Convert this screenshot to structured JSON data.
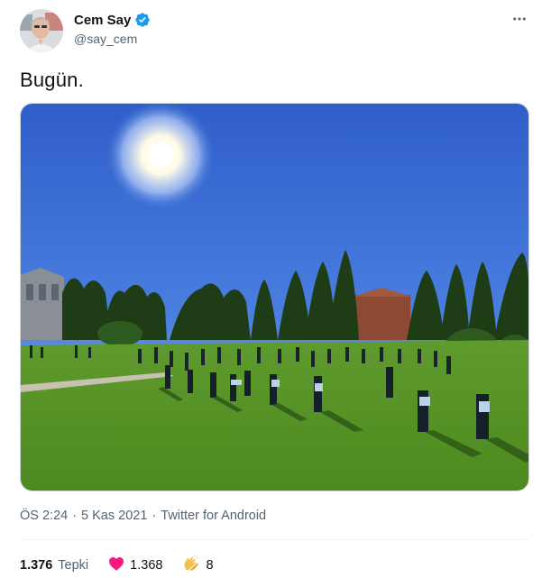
{
  "author": {
    "display_name": "Cem Say",
    "handle": "@say_cem",
    "verified": true
  },
  "tweet": {
    "text": "Bugün.",
    "time": "ÖS 2:24",
    "separator": "·",
    "date": "5 Kas 2021",
    "source": "Twitter for Android"
  },
  "stats": {
    "reactions_count": "1.376",
    "reactions_label": "Tepki",
    "likes_count": "1.368",
    "claps_count": "8"
  },
  "icons": {
    "more": "more-horizontal-icon",
    "verified": "verified-badge-icon",
    "like": "heart-icon",
    "clap": "clapping-hands-icon"
  },
  "colors": {
    "verified_blue": "#1d9bf0",
    "heart_pink": "#f91880",
    "muted_text": "#536471",
    "text": "#0f1419"
  }
}
